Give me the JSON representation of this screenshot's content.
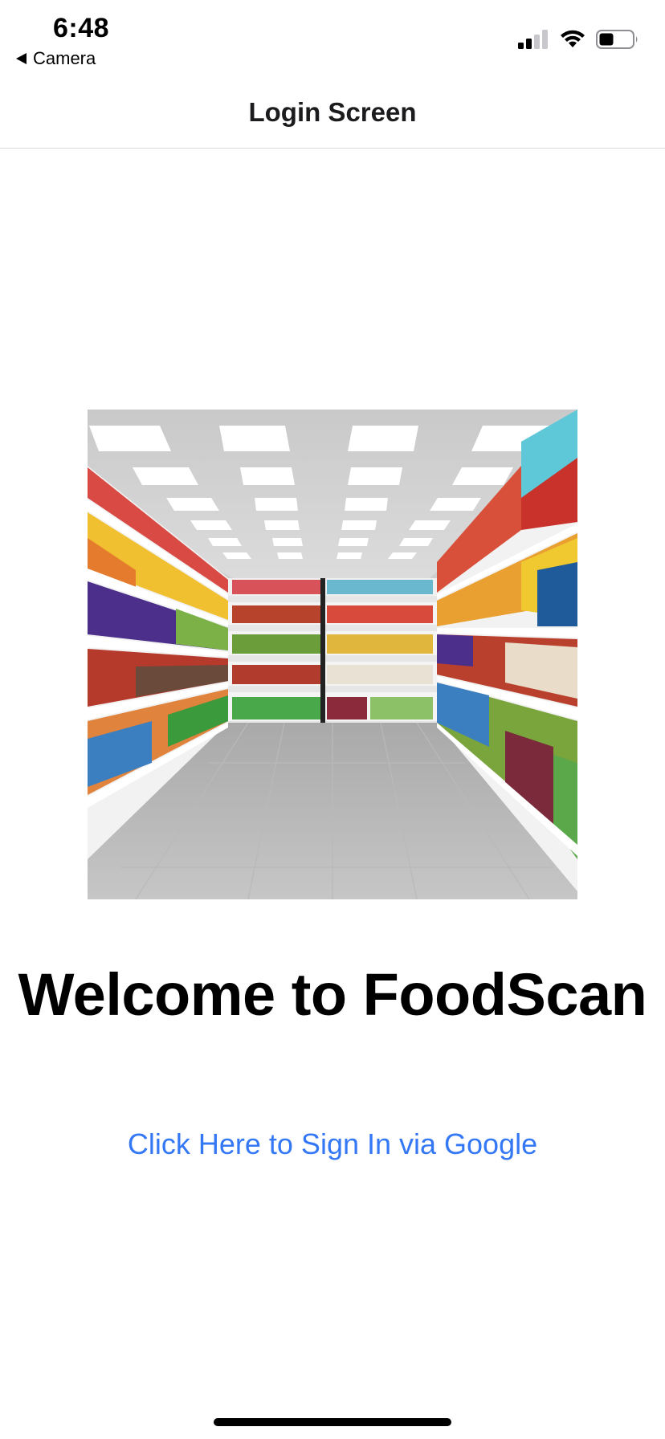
{
  "status_bar": {
    "time": "6:48",
    "back_app": "Camera",
    "icons": [
      "cellular-signal-icon",
      "wifi-icon",
      "battery-icon"
    ]
  },
  "nav": {
    "title": "Login Screen"
  },
  "hero_image": {
    "subject": "supermarket-aisle-image"
  },
  "main": {
    "welcome": "Welcome to FoodScan",
    "signin_link": "Click Here to Sign In via Google"
  },
  "colors": {
    "link": "#3478f6",
    "background": "#ffffff",
    "text": "#000000"
  }
}
